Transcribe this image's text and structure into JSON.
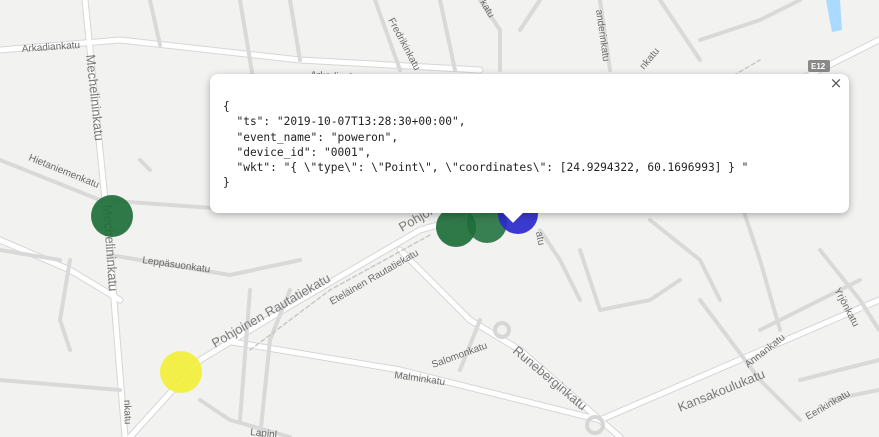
{
  "map": {
    "streets": {
      "arkadiankatu": "Arkadiankatu",
      "mechelininkatu": "Mechelininkatu",
      "hietaniemenkatu": "Hietaniemenkatu",
      "leppasuonkatu": "Leppäsuonkatu",
      "pohjoinen_rautatiekatu": "Pohjoinen Rautatiekatu",
      "etelainen_rautatiekatu": "Eteläinen Rautatiekatu",
      "pohjoi": "Pohjoi",
      "salomonkatu": "Salomonkatu",
      "runeberginkatu": "Runeberginkatu",
      "malminkatu": "Malminkatu",
      "kansakoulukatu": "Kansakoulukatu",
      "annankatu": "Annankatu",
      "yrjonkatu": "Yrjönkatu",
      "eerikinkatu": "Eerikinkatu",
      "lapinlahdenkatu": "Lapinl",
      "fredrikinkatu": "Fredrikinkatu",
      "vanderinkatu": "anderinkatu",
      "katu_fragment": "katu",
      "nkatu_fragment": "nkatu",
      "atu_fragment": "atu",
      "mech_bottom": "nkatu",
      "ankatu_top": "Arkadiankatu"
    },
    "road_badge": "E12",
    "markers": [
      {
        "color": "#1e6e3a",
        "label": "green-marker"
      },
      {
        "color": "#1e6e3a",
        "label": "green-marker"
      },
      {
        "color": "#1e6e3a",
        "label": "green-marker"
      },
      {
        "color": "#2a2acc",
        "label": "blue-marker"
      },
      {
        "color": "#f2f03a",
        "label": "yellow-marker"
      }
    ]
  },
  "popup": {
    "close_label": "×",
    "json_text": "{\n  \"ts\": \"2019-10-07T13:28:30+00:00\",\n  \"event_name\": \"poweron\",\n  \"device_id\": \"0001\",\n  \"wkt\": \"{ \\\"type\\\": \\\"Point\\\", \\\"coordinates\\\": [24.9294322, 60.1696993] } \"\n}"
  }
}
